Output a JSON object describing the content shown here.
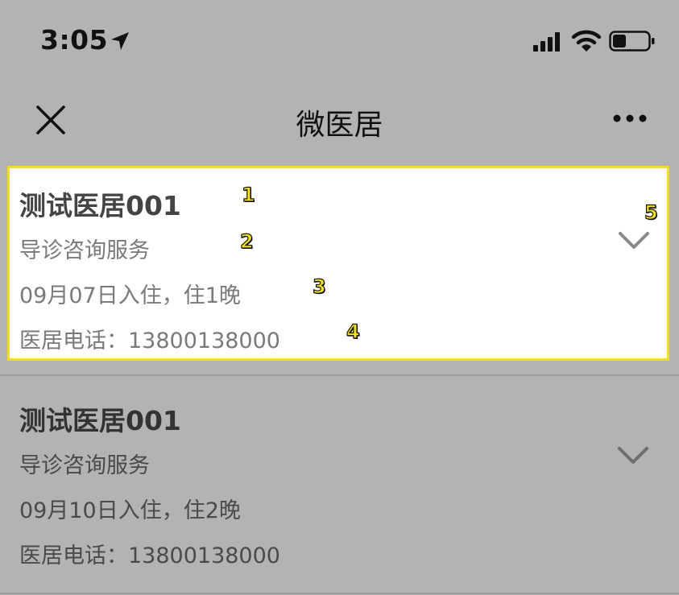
{
  "status_bar": {
    "time": "3:05"
  },
  "nav": {
    "title": "微医居"
  },
  "cards": [
    {
      "name": "测试医居001",
      "service": "导诊咨询服务",
      "stay": "09月07日入住，住1晚",
      "phone": "医居电话：13800138000"
    },
    {
      "name": "测试医居001",
      "service": "导诊咨询服务",
      "stay": "09月10日入住，住2晚",
      "phone": "医居电话：13800138000"
    }
  ],
  "markers": [
    "1",
    "2",
    "3",
    "4",
    "5"
  ],
  "colors": {
    "overlay": "#b3b3b3",
    "highlight_border": "#f2df1f",
    "marker": "#f8e21a"
  }
}
